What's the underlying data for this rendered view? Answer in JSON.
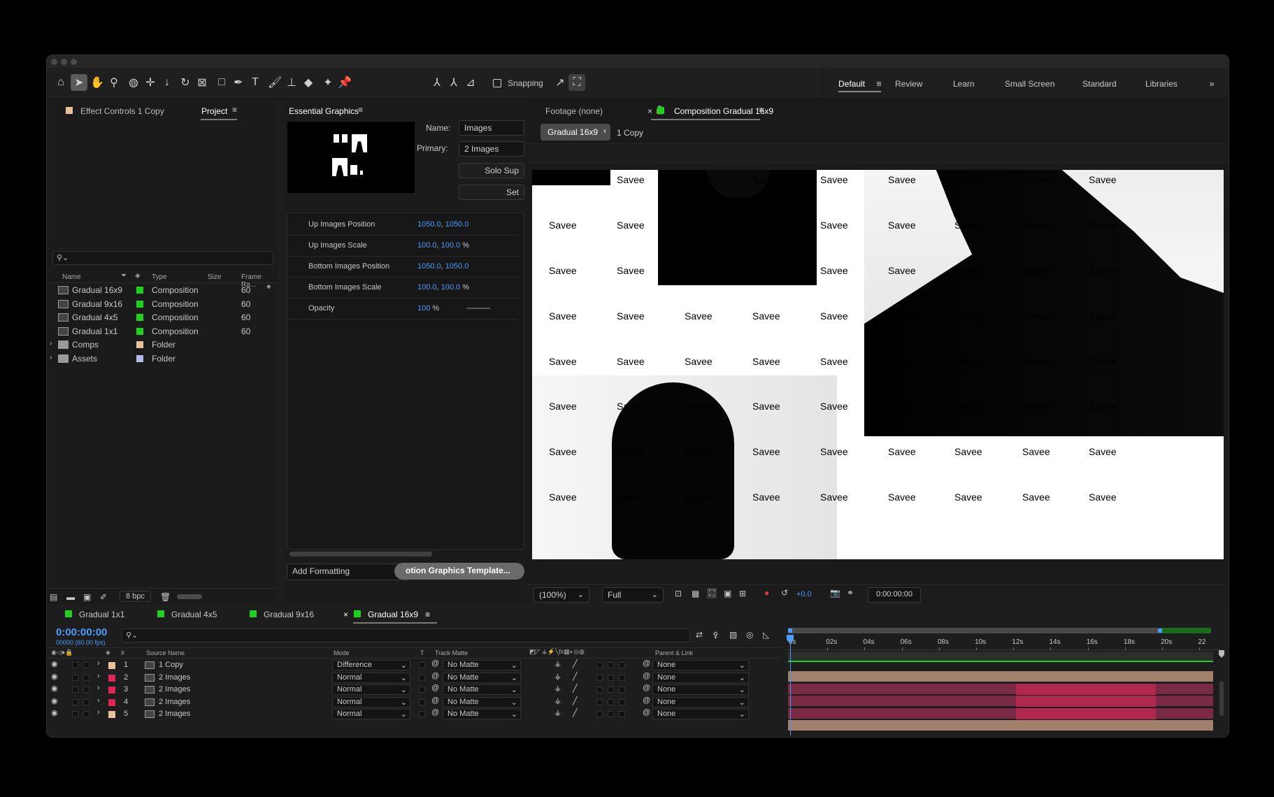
{
  "toolbar": {
    "snapping_label": "Snapping",
    "workspaces": [
      "Default",
      "Review",
      "Learn",
      "Small Screen",
      "Standard",
      "Libraries"
    ],
    "active_workspace": "Default"
  },
  "project_panel": {
    "tab_effect_controls": "Effect Controls 1 Copy",
    "tab_project": "Project",
    "search_placeholder": "",
    "columns": [
      "Name",
      "Type",
      "Size",
      "Frame Ra..."
    ],
    "items": [
      {
        "name": "Gradual 16x9",
        "type": "Composition",
        "fps": "60",
        "color": "#1fd11f"
      },
      {
        "name": "Gradual 9x16",
        "type": "Composition",
        "fps": "60",
        "color": "#1fd11f"
      },
      {
        "name": "Gradual 4x5",
        "type": "Composition",
        "fps": "60",
        "color": "#1fd11f"
      },
      {
        "name": "Gradual 1x1",
        "type": "Composition",
        "fps": "60",
        "color": "#1fd11f"
      },
      {
        "name": "Comps",
        "type": "Folder",
        "fps": "",
        "color": "#e8c39a"
      },
      {
        "name": "Assets",
        "type": "Folder",
        "fps": "",
        "color": "#b8b8e8"
      }
    ],
    "bpc_label": "8 bpc"
  },
  "essential_graphics": {
    "title": "Essential Graphics",
    "name_label": "Name:",
    "name_value": "Images",
    "primary_label": "Primary:",
    "primary_value": "2 Images",
    "solo_button": "Solo Sup",
    "set_button": "Set",
    "properties": [
      {
        "label": "Up Images Position",
        "v1": "1050.0",
        "v2": "1050.0",
        "unit": ""
      },
      {
        "label": "Up Images Scale",
        "v1": "100.0",
        "v2": "100.0",
        "unit": "%"
      },
      {
        "label": "Bottom Images Position",
        "v1": "1050.0",
        "v2": "1050.0",
        "unit": ""
      },
      {
        "label": "Bottom Images Scale",
        "v1": "100.0",
        "v2": "100.0",
        "unit": "%"
      },
      {
        "label": "Opacity",
        "v1": "100",
        "v2": "",
        "unit": "%"
      }
    ],
    "add_formatting": "Add Formatting",
    "export_button": "otion Graphics Template..."
  },
  "viewer": {
    "footage_tab": "Footage (none)",
    "comp_tab": "Composition Gradual 16x9",
    "breadcrumb_active": "Gradual 16x9",
    "breadcrumb_next": "1 Copy",
    "watermark": "Savee",
    "zoom": "(100%)",
    "resolution": "Full",
    "exposure": "+0.0",
    "timecode": "0:00:00:00"
  },
  "timeline": {
    "tabs": [
      {
        "label": "Gradual 1x1",
        "active": false
      },
      {
        "label": "Gradual 4x5",
        "active": false
      },
      {
        "label": "Gradual 9x16",
        "active": false
      },
      {
        "label": "Gradual 16x9",
        "active": true
      }
    ],
    "current_time": "0:00:00:00",
    "frame_info": "00000 (60.00 fps)",
    "col_source": "Source Name",
    "col_mode": "Mode",
    "col_t": "T",
    "col_matte": "Track Matte",
    "col_parent": "Parent & Link",
    "ruler": [
      "0s",
      "02s",
      "04s",
      "06s",
      "08s",
      "10s",
      "12s",
      "14s",
      "16s",
      "18s",
      "20s",
      "22"
    ],
    "layers": [
      {
        "num": "1",
        "name": "1 Copy",
        "mode": "Difference",
        "matte": "No Matte",
        "parent": "None",
        "color": "#e8c39a"
      },
      {
        "num": "2",
        "name": "2 Images",
        "mode": "Normal",
        "matte": "No Matte",
        "parent": "None",
        "color": "#e0245a"
      },
      {
        "num": "3",
        "name": "2 Images",
        "mode": "Normal",
        "matte": "No Matte",
        "parent": "None",
        "color": "#e0245a"
      },
      {
        "num": "4",
        "name": "2 Images",
        "mode": "Normal",
        "matte": "No Matte",
        "parent": "None",
        "color": "#e0245a"
      },
      {
        "num": "5",
        "name": "2 Images",
        "mode": "Normal",
        "matte": "No Matte",
        "parent": "None",
        "color": "#e8c39a"
      }
    ]
  }
}
